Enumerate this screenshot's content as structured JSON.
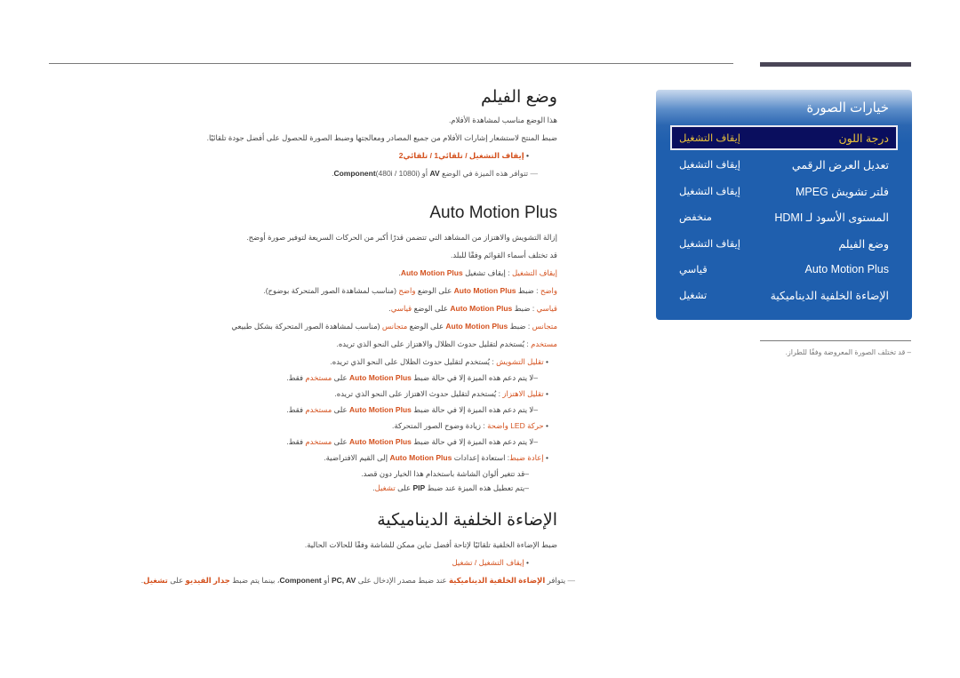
{
  "panel": {
    "title": "خيارات الصورة",
    "items": [
      {
        "label": "درجة اللون",
        "value": "إيقاف التشغيل",
        "selected": true
      },
      {
        "label": "تعديل العرض الرقمي",
        "value": "إيقاف التشغيل"
      },
      {
        "label": "فلتر تشويش MPEG",
        "value": "إيقاف التشغيل"
      },
      {
        "label": "المستوى الأسود لـ HDMI",
        "value": "منخفض"
      },
      {
        "label": "وضع الفيلم",
        "value": "إيقاف التشغيل"
      },
      {
        "label": "Auto Motion Plus",
        "value": "قياسي"
      },
      {
        "label": "الإضاءة الخلفية الديناميكية",
        "value": "تشغيل"
      }
    ],
    "note": "– قد تختلف الصورة المعروضة وفقًا للطراز."
  },
  "film_mode": {
    "title": "وضع الفيلم",
    "desc1": "هذا الوضع مناسب لمشاهدة الأفلام.",
    "desc2": "ضبط المنتج لاستشعار إشارات الأفلام من جميع المصادر ومعالجتها وضبط الصورة للحصول على أفضل جودة تلقائيًا.",
    "options": "إيقاف التشغيل / تلقائي1 / تلقائي2",
    "note_pre": "تتوافر هذه الميزة في الوضع ",
    "note_av": "AV",
    "note_or": " أو ",
    "note_component": "Component",
    "note_post": "(480i / 1080i)."
  },
  "amp": {
    "title": "Auto Motion Plus",
    "desc1": "إزالة التشويش والاهتزاز من المشاهد التي تتضمن قدرًا أكبر من الحركات السريعة لتوفير صورة أوضح.",
    "desc2": "قد تختلف أسماء القوائم وفقًا للبلد.",
    "brand": "Auto Motion Plus",
    "off_label": "إيقاف التشغيل",
    "off_text": " : إيقاف تشغيل ",
    "clear_label": "واضح",
    "clear_text1": " : ضبط ",
    "clear_text2": " على الوضع ",
    "clear_text3": " (مناسب لمشاهدة الصور المتحركة بوضوح).",
    "std_label": "قياسي",
    "std_text1": " : ضبط ",
    "std_text2": " على الوضع ",
    "std_text3": ".",
    "smooth_label": "متجانس",
    "smooth_text1": " : ضبط ",
    "smooth_text2": " على الوضع ",
    "smooth_text3": " (مناسب لمشاهدة الصور المتحركة بشكل طبيعي",
    "custom_label": "مستخدم",
    "custom_text": " : يُستخدم لتقليل حدوث الظلال والاهتزاز على النحو الذي تريده.",
    "blur_label": "تقليل التشويش",
    "blur_text": " : يُستخدم لتقليل حدوث الظلال على النحو الذي تريده.",
    "only_pre": "–لا يتم دعم هذه الميزة إلا في حالة ضبط ",
    "only_mid": " على ",
    "only_custom": "مستخدم",
    "only_post": " فقط.",
    "judder_label": "تقليل الاهتزاز",
    "judder_text": " : يُستخدم لتقليل حدوث الاهتزاز على النحو الذي تريده.",
    "led_label": "حركة LED واضحة",
    "led_text": " : زيادة وضوح الصور المتحركة.",
    "reset_label": "إعادة ضبط",
    "reset_text1": ": استعادة إعدادات ",
    "reset_text2": " إلى القيم الافتراضية.",
    "reset_note1": "–قد تتغير ألوان الشاشة باستخدام هذا الخيار دون قصد.",
    "reset_note2_pre": "–يتم تعطيل هذه الميزة عند ضبط ",
    "reset_note2_pip": "PIP",
    "reset_note2_mid": " على ",
    "reset_note2_on": "تشغيل",
    "reset_note2_post": "."
  },
  "dbl": {
    "title": "الإضاءة الخلفية الديناميكية",
    "desc": "ضبط الإضاءة الخلفية تلقائيًا لإتاحة أفضل تباين ممكن للشاشة وفقًا للحالات الحالية.",
    "opt_off": "إيقاف التشغيل",
    "opt_sep": " / ",
    "opt_on": "تشغيل",
    "note_pre": "يتوافر ",
    "note_feature": "الإضاءة الخلفية الديناميكية",
    "note_mid1": " عند ضبط مصدر الإدخال على ",
    "note_pcav": "PC, AV",
    "note_or": " أو ",
    "note_component": "Component",
    "note_mid2": "، بينما يتم ضبط ",
    "note_videowall": "جدار الفيديو",
    "note_on_pre": " على ",
    "note_on": "تشغيل",
    "note_post": "."
  }
}
